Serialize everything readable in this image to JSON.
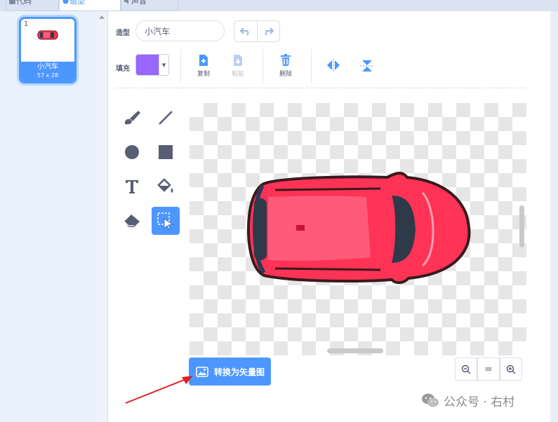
{
  "tabs": {
    "code": "代码",
    "costumes": "造型",
    "sounds": "声音"
  },
  "costume_list": {
    "number": "1",
    "name": "小汽车",
    "size": "57 x 28"
  },
  "toolbar": {
    "costume_label": "造型",
    "costume_name": "小汽车",
    "fill_label": "填充",
    "fill_color": "#9966ff",
    "copy": "复制",
    "paste": "粘贴",
    "delete": "删除"
  },
  "canvas": {
    "car_color": "#ff3355"
  },
  "convert_button": "转换为矢量图",
  "zoom": {
    "out": "−",
    "reset": "=",
    "in": "+"
  },
  "watermark": "公众号 · 右村"
}
